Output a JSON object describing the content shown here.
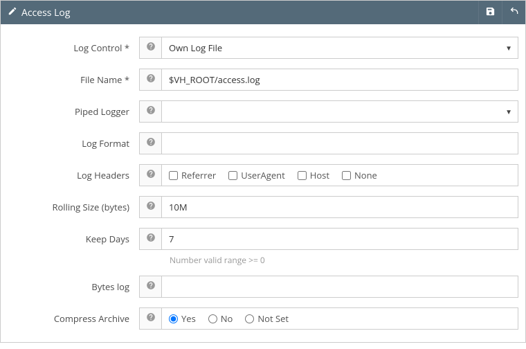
{
  "header": {
    "title": "Access Log"
  },
  "fields": {
    "log_control": {
      "label": "Log Control",
      "required": true,
      "value": "Own Log File"
    },
    "file_name": {
      "label": "File Name",
      "required": true,
      "value": "$VH_ROOT/access.log"
    },
    "piped_logger": {
      "label": "Piped Logger",
      "value": ""
    },
    "log_format": {
      "label": "Log Format",
      "value": ""
    },
    "log_headers": {
      "label": "Log Headers",
      "options": {
        "referrer": "Referrer",
        "useragent": "UserAgent",
        "host": "Host",
        "none": "None"
      }
    },
    "rolling_size": {
      "label": "Rolling Size (bytes)",
      "value": "10M"
    },
    "keep_days": {
      "label": "Keep Days",
      "value": "7",
      "hint": "Number valid range >= 0"
    },
    "bytes_log": {
      "label": "Bytes log",
      "value": ""
    },
    "compress_archive": {
      "label": "Compress Archive",
      "options": {
        "yes": "Yes",
        "no": "No",
        "notset": "Not Set"
      },
      "selected": "yes"
    }
  }
}
